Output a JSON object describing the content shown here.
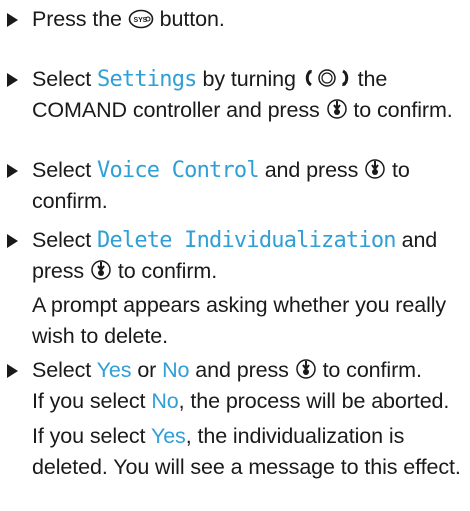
{
  "steps": [
    {
      "pre": "Press the",
      "post": "button."
    },
    {
      "pre": "Select",
      "menu": "Settings",
      "mid": "by turning",
      "post1": "the COMAND controller and press",
      "post2": "to confirm."
    },
    {
      "pre": "Select",
      "menu": "Voice Control",
      "mid": "and press",
      "post": "to confirm."
    },
    {
      "pre": "Select",
      "menu": "Delete Individualization",
      "mid": "and press",
      "post": "to confirm.",
      "note": "A prompt appears asking whether you really wish to delete."
    },
    {
      "pre": "Select",
      "opt1": "Yes",
      "or": "or",
      "opt2": "No",
      "mid": "and press",
      "post": "to confirm.",
      "note1_pre": "If you select",
      "note1_opt": "No",
      "note1_post": ", the process will be aborted.",
      "note2_pre": "If you select",
      "note2_opt": "Yes",
      "note2_post": ", the individualization is deleted. You will see a message to this effect."
    }
  ],
  "icons": {
    "sys_button": "sys-button-icon",
    "rotate_controller": "rotate-controller-icon",
    "press_confirm": "press-controller-icon"
  },
  "colors": {
    "accent": "#2f9fd6",
    "text": "#1a1a1a"
  }
}
